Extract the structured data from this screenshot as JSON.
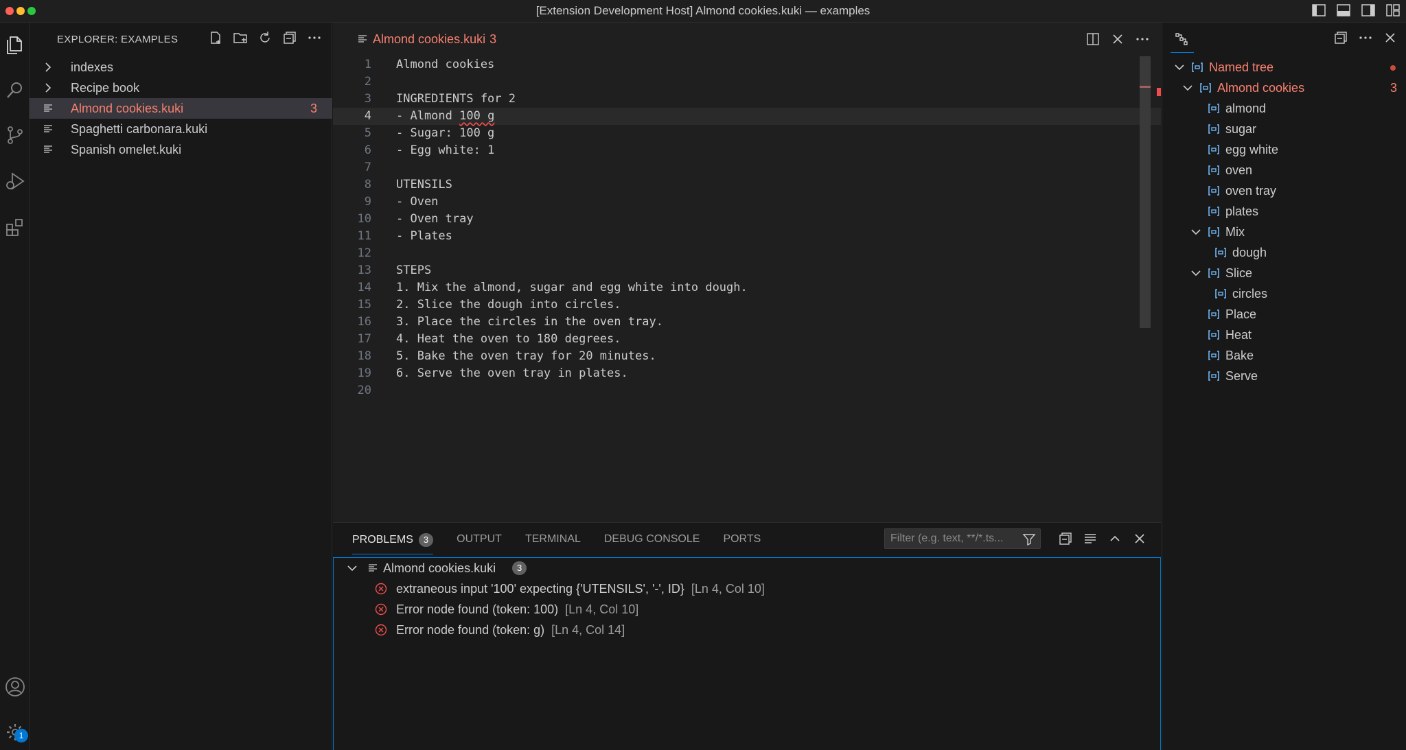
{
  "window": {
    "title": "[Extension Development Host] Almond cookies.kuki — examples"
  },
  "activity_bar": {
    "items": [
      "files-icon",
      "search-icon",
      "source-control-icon",
      "run-debug-icon",
      "extensions-icon"
    ],
    "bottom": [
      "account-icon",
      "settings-icon"
    ],
    "settings_badge": "1"
  },
  "sidebar": {
    "title": "EXPLORER: EXAMPLES",
    "items": [
      {
        "label": "indexes",
        "type": "folder"
      },
      {
        "label": "Recipe book",
        "type": "folder"
      },
      {
        "label": "Almond cookies.kuki",
        "type": "file",
        "count": "3"
      },
      {
        "label": "Spaghetti carbonara.kuki",
        "type": "file"
      },
      {
        "label": "Spanish omelet.kuki",
        "type": "file"
      }
    ]
  },
  "editor": {
    "tab": {
      "label": "Almond cookies.kuki",
      "count": "3"
    },
    "lines": [
      {
        "n": "1",
        "text": "Almond cookies"
      },
      {
        "n": "2",
        "text": ""
      },
      {
        "n": "3",
        "text": "INGREDIENTS for 2"
      },
      {
        "n": "4",
        "text_a": "- Almond ",
        "text_b": "100 g",
        "text_c": ""
      },
      {
        "n": "5",
        "text": "- Sugar: 100 g"
      },
      {
        "n": "6",
        "text": "- Egg white: 1"
      },
      {
        "n": "7",
        "text": ""
      },
      {
        "n": "8",
        "text": "UTENSILS"
      },
      {
        "n": "9",
        "text": "- Oven"
      },
      {
        "n": "10",
        "text": "- Oven tray"
      },
      {
        "n": "11",
        "text": "- Plates"
      },
      {
        "n": "12",
        "text": ""
      },
      {
        "n": "13",
        "text": "STEPS"
      },
      {
        "n": "14",
        "text": "1. Mix the almond, sugar and egg white into dough."
      },
      {
        "n": "15",
        "text": "2. Slice the dough into circles."
      },
      {
        "n": "16",
        "text": "3. Place the circles in the oven tray."
      },
      {
        "n": "17",
        "text": "4. Heat the oven to 180 degrees."
      },
      {
        "n": "18",
        "text": "5. Bake the oven tray for 20 minutes."
      },
      {
        "n": "19",
        "text": "6. Serve the oven tray in plates."
      },
      {
        "n": "20",
        "text": ""
      }
    ]
  },
  "panel": {
    "tabs": [
      {
        "label": "PROBLEMS",
        "count": "3"
      },
      {
        "label": "OUTPUT"
      },
      {
        "label": "TERMINAL"
      },
      {
        "label": "DEBUG CONSOLE"
      },
      {
        "label": "PORTS"
      }
    ],
    "filter_placeholder": "Filter (e.g. text, **/*.ts...",
    "file": {
      "label": "Almond cookies.kuki",
      "count": "3"
    },
    "problems": [
      {
        "message": "extraneous input '100' expecting {'UTENSILS', '-', ID}",
        "location": "[Ln 4, Col 10]"
      },
      {
        "message": "Error node found (token: 100)",
        "location": "[Ln 4, Col 10]"
      },
      {
        "message": "Error node found (token: g)",
        "location": "[Ln 4, Col 14]"
      }
    ]
  },
  "named_tree": {
    "root": "Named tree",
    "doc": {
      "label": "Almond cookies",
      "count": "3"
    },
    "items": [
      {
        "label": "almond"
      },
      {
        "label": "sugar"
      },
      {
        "label": "egg white"
      },
      {
        "label": "oven"
      },
      {
        "label": "oven tray"
      },
      {
        "label": "plates"
      },
      {
        "label": "Mix",
        "child": "dough"
      },
      {
        "label": "Slice",
        "child": "circles"
      },
      {
        "label": "Place"
      },
      {
        "label": "Heat"
      },
      {
        "label": "Bake"
      },
      {
        "label": "Serve"
      }
    ]
  },
  "colors": {
    "accent": "#0078d4",
    "error": "#f14c4c",
    "error_text": "#f88070",
    "symbol": "#75beff"
  }
}
